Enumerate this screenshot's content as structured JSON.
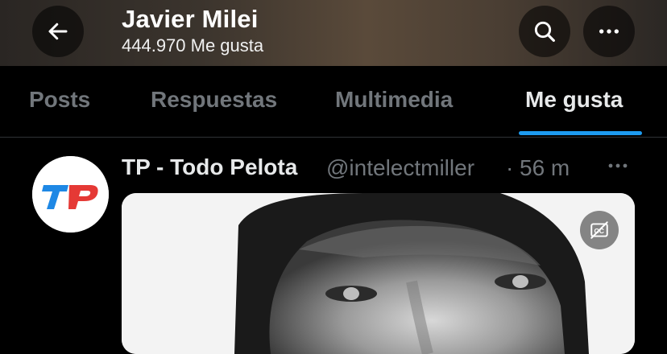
{
  "header": {
    "name": "Javier Milei",
    "likes_subtitle": "444.970 Me gusta",
    "back_icon": "arrow-left-icon",
    "search_icon": "search-icon",
    "more_icon": "more-horizontal-icon"
  },
  "tabs": [
    {
      "label": "Posts",
      "active": false
    },
    {
      "label": "Respuestas",
      "active": false
    },
    {
      "label": "Multimedia",
      "active": false
    },
    {
      "label": "Me gusta",
      "active": true
    }
  ],
  "post": {
    "author_name": "TP - Todo Pelota",
    "author_handle": "@intelectmiller",
    "separator": "·",
    "time": "56 m",
    "avatar_text": "TP",
    "captions_icon": "captions-off-icon",
    "more_icon": "more-horizontal-icon"
  },
  "colors": {
    "accent": "#1d9bf0",
    "muted_text": "#71767b",
    "primary_text": "#e7e9ea",
    "logo_red": "#e53935",
    "logo_blue": "#1e88e5"
  }
}
